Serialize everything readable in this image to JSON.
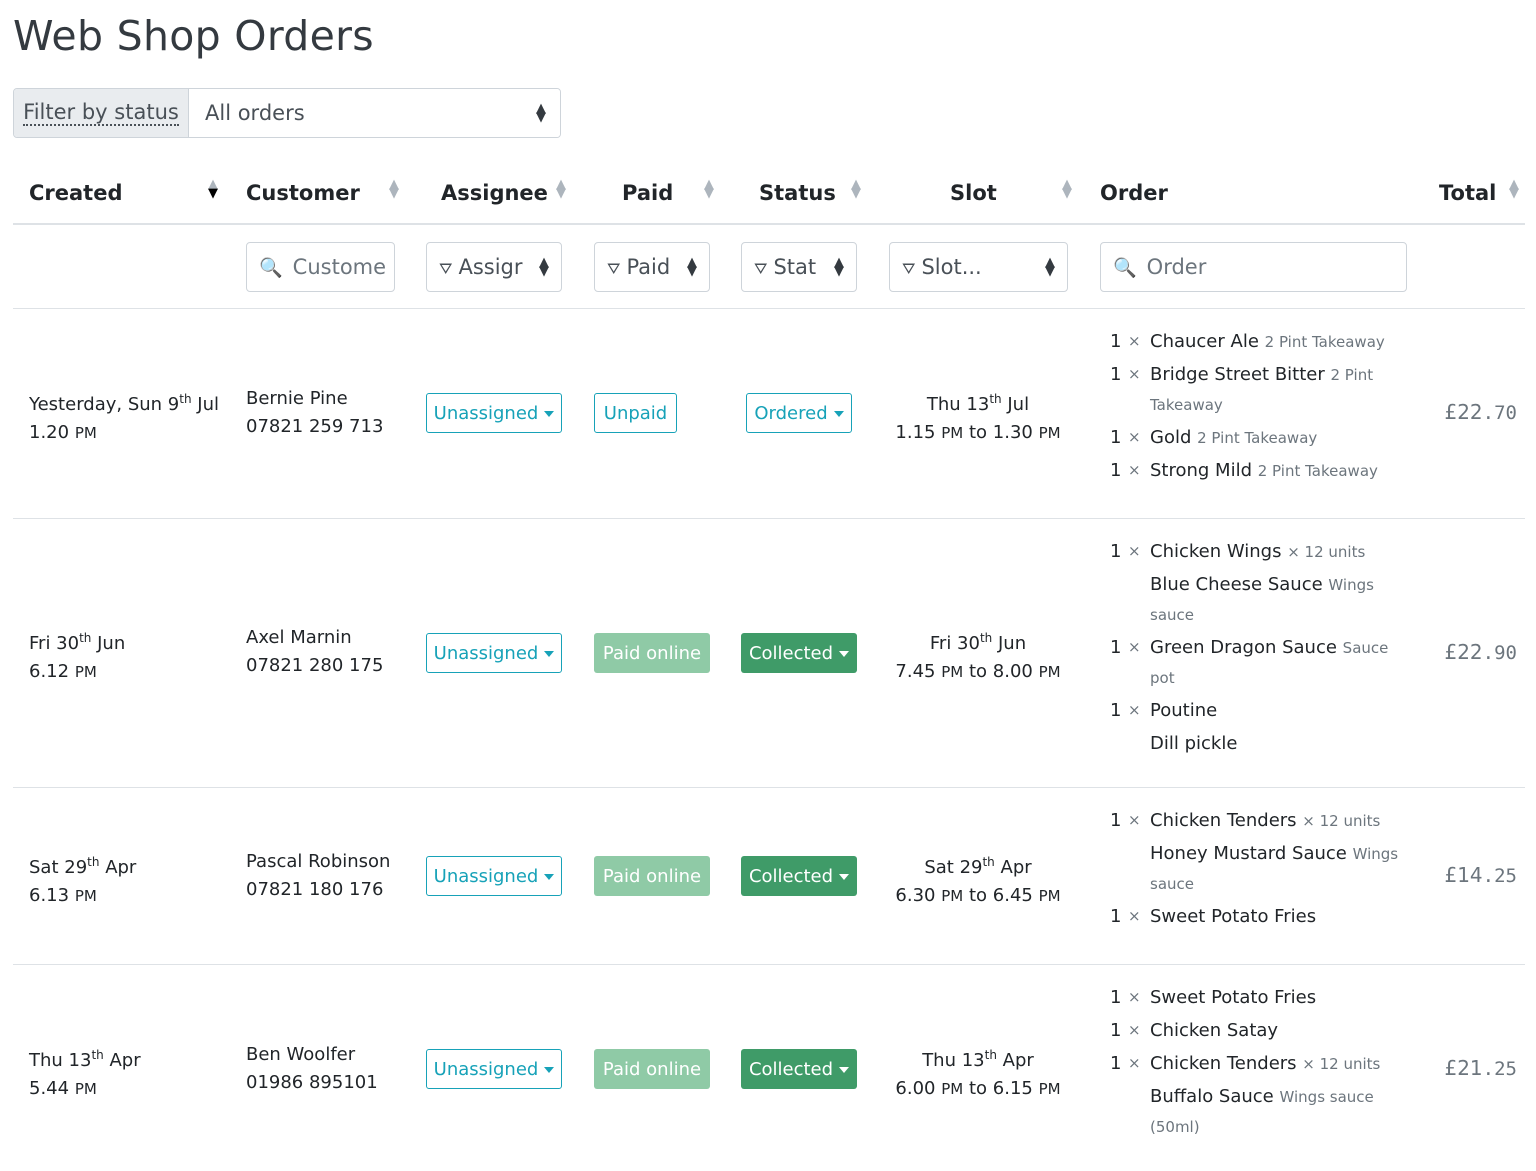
{
  "page": {
    "title": "Web Shop Orders"
  },
  "filter": {
    "label": "Filter by status",
    "selected": "All orders"
  },
  "columns": {
    "created": "Created",
    "customer": "Customer",
    "assignee": "Assignee",
    "paid": "Paid",
    "status": "Status",
    "slot": "Slot",
    "order": "Order",
    "total": "Total"
  },
  "column_filters": {
    "customer_placeholder": "Custome",
    "assignee": "Assigr",
    "paid": "Paid",
    "status": "Stat",
    "slot": "Slot...",
    "order_placeholder": "Order"
  },
  "orders": [
    {
      "created": {
        "day": "Yesterday, Sun 9",
        "ord": "th",
        "month": "Jul",
        "time": "1.20",
        "ampm": "PM"
      },
      "customer": {
        "name": "Bernie Pine",
        "phone": "07821 259 713"
      },
      "assignee": "Unassigned",
      "paid": "Unpaid",
      "status": "Ordered",
      "slot": {
        "day": "Thu 13",
        "ord": "th",
        "month": "Jul",
        "start": "1.15",
        "start_ampm": "PM",
        "to": "to",
        "end": "1.30",
        "end_ampm": "PM"
      },
      "items": [
        {
          "qty": "1",
          "x": "×",
          "name": "Chaucer Ale",
          "opt": "2 Pint Takeaway"
        },
        {
          "qty": "1",
          "x": "×",
          "name": "Bridge Street Bitter",
          "opt": "2 Pint Takeaway"
        },
        {
          "qty": "1",
          "x": "×",
          "name": "Gold",
          "opt": "2 Pint Takeaway"
        },
        {
          "qty": "1",
          "x": "×",
          "name": "Strong Mild",
          "opt": "2 Pint Takeaway"
        }
      ],
      "total": {
        "pounds": "£22",
        "pence": ".70"
      }
    },
    {
      "created": {
        "day": "Fri 30",
        "ord": "th",
        "month": "Jun",
        "time": "6.12",
        "ampm": "PM"
      },
      "customer": {
        "name": "Axel Marnin",
        "phone": "07821 280 175"
      },
      "assignee": "Unassigned",
      "paid": "Paid online",
      "status": "Collected",
      "slot": {
        "day": "Fri 30",
        "ord": "th",
        "month": "Jun",
        "start": "7.45",
        "start_ampm": "PM",
        "to": "to",
        "end": "8.00",
        "end_ampm": "PM"
      },
      "items": [
        {
          "qty": "1",
          "x": "×",
          "name": "Chicken Wings",
          "opt": "× 12 units"
        },
        {
          "qty": "",
          "x": "",
          "name": "Blue Cheese Sauce",
          "opt": "Wings sauce"
        },
        {
          "qty": "1",
          "x": "×",
          "name": "Green Dragon Sauce",
          "opt": "Sauce pot"
        },
        {
          "qty": "1",
          "x": "×",
          "name": "Poutine",
          "opt": ""
        },
        {
          "qty": "",
          "x": "",
          "name": "Dill pickle",
          "opt": ""
        }
      ],
      "total": {
        "pounds": "£22",
        "pence": ".90"
      }
    },
    {
      "created": {
        "day": "Sat 29",
        "ord": "th",
        "month": "Apr",
        "time": "6.13",
        "ampm": "PM"
      },
      "customer": {
        "name": "Pascal Robinson",
        "phone": "07821 180 176"
      },
      "assignee": "Unassigned",
      "paid": "Paid online",
      "status": "Collected",
      "slot": {
        "day": "Sat 29",
        "ord": "th",
        "month": "Apr",
        "start": "6.30",
        "start_ampm": "PM",
        "to": "to",
        "end": "6.45",
        "end_ampm": "PM"
      },
      "items": [
        {
          "qty": "1",
          "x": "×",
          "name": "Chicken Tenders",
          "opt": "× 12 units"
        },
        {
          "qty": "",
          "x": "",
          "name": "Honey Mustard Sauce",
          "opt": "Wings sauce"
        },
        {
          "qty": "1",
          "x": "×",
          "name": "Sweet Potato Fries",
          "opt": ""
        }
      ],
      "total": {
        "pounds": "£14",
        "pence": ".25"
      }
    },
    {
      "created": {
        "day": "Thu 13",
        "ord": "th",
        "month": "Apr",
        "time": "5.44",
        "ampm": "PM"
      },
      "customer": {
        "name": "Ben Woolfer",
        "phone": "01986 895101"
      },
      "assignee": "Unassigned",
      "paid": "Paid online",
      "status": "Collected",
      "slot": {
        "day": "Thu 13",
        "ord": "th",
        "month": "Apr",
        "start": "6.00",
        "start_ampm": "PM",
        "to": "to",
        "end": "6.15",
        "end_ampm": "PM"
      },
      "items": [
        {
          "qty": "1",
          "x": "×",
          "name": "Sweet Potato Fries",
          "opt": ""
        },
        {
          "qty": "1",
          "x": "×",
          "name": "Chicken Satay",
          "opt": ""
        },
        {
          "qty": "1",
          "x": "×",
          "name": "Chicken Tenders",
          "opt": "× 12 units"
        },
        {
          "qty": "",
          "x": "",
          "name": "Buffalo Sauce",
          "opt": "Wings sauce (50ml)"
        }
      ],
      "total": {
        "pounds": "£21",
        "pence": ".25"
      }
    }
  ],
  "icons": {
    "sort": "sort-updown-icon",
    "search": "magnifier-icon",
    "filter": "funnel-icon",
    "dropdown": "caret-down-icon"
  },
  "colors": {
    "info": "#17a2b8",
    "paid": "#8fcaa6",
    "collected": "#3f9b68"
  }
}
